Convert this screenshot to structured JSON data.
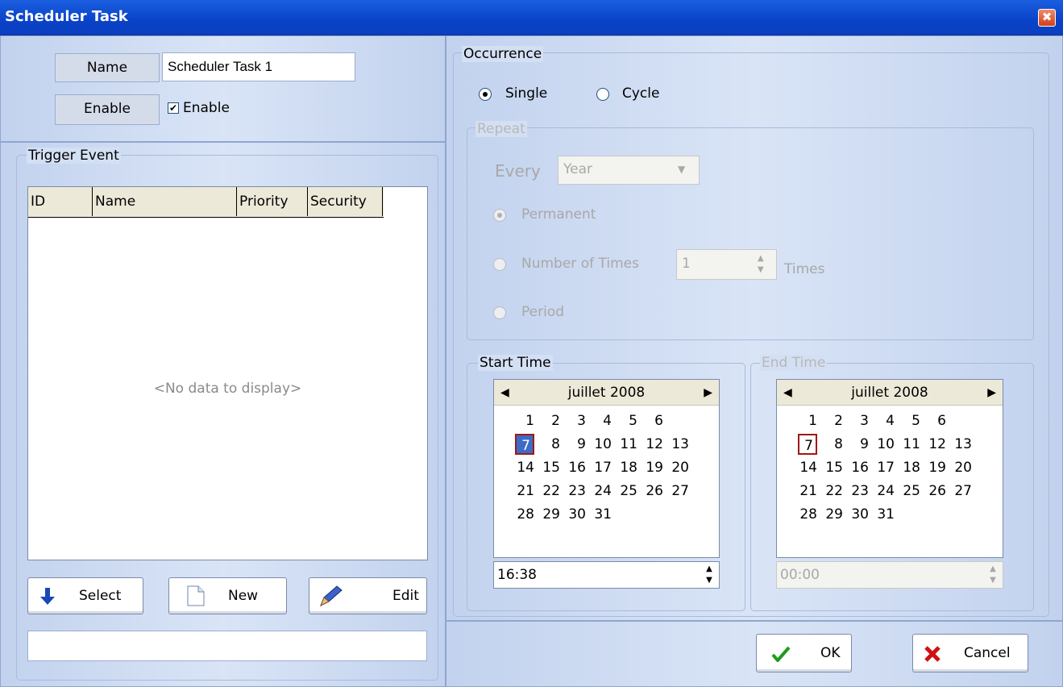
{
  "window": {
    "title": "Scheduler Task",
    "close_glyph": "✖"
  },
  "header": {
    "name_label": "Name",
    "name_value": "Scheduler Task 1",
    "enable_label": "Enable",
    "enable_checkbox_label": "Enable",
    "enable_checked": true
  },
  "trigger": {
    "legend": "Trigger Event",
    "columns": [
      "ID",
      "Name",
      "Priority",
      "Security"
    ],
    "empty_text": "<No data to display>",
    "buttons": {
      "select": "Select",
      "new": "New",
      "edit": "Edit"
    },
    "status_value": ""
  },
  "occurrence": {
    "legend": "Occurrence",
    "single_label": "Single",
    "cycle_label": "Cycle",
    "selected": "single",
    "repeat": {
      "legend": "Repeat",
      "every_label": "Every",
      "every_value": "Year",
      "permanent_label": "Permanent",
      "number_label": "Number of Times",
      "number_value": "1",
      "times_label": "Times",
      "period_label": "Period",
      "selected": "permanent"
    }
  },
  "start_time": {
    "legend": "Start Time",
    "month": "juillet 2008",
    "selected_day": "7",
    "time": "16:38"
  },
  "end_time": {
    "legend": "End Time",
    "month": "juillet 2008",
    "selected_day": "7",
    "time": "00:00"
  },
  "calendar_weeks": [
    [
      "",
      "",
      "",
      "",
      "1",
      "2",
      "3",
      "4",
      "5",
      "6"
    ],
    [
      "7",
      "8",
      "9",
      "10",
      "11",
      "12",
      "13"
    ],
    [
      "14",
      "15",
      "16",
      "17",
      "18",
      "19",
      "20"
    ],
    [
      "21",
      "22",
      "23",
      "24",
      "25",
      "26",
      "27"
    ],
    [
      "28",
      "29",
      "30",
      "31"
    ]
  ],
  "footer": {
    "ok": "OK",
    "cancel": "Cancel"
  },
  "colors": {
    "accent": "#0a42c8",
    "selected_day": "#3c6bc8",
    "today_border": "#a01818",
    "ok_check": "#1e9a1e",
    "cancel_x": "#d01010"
  }
}
